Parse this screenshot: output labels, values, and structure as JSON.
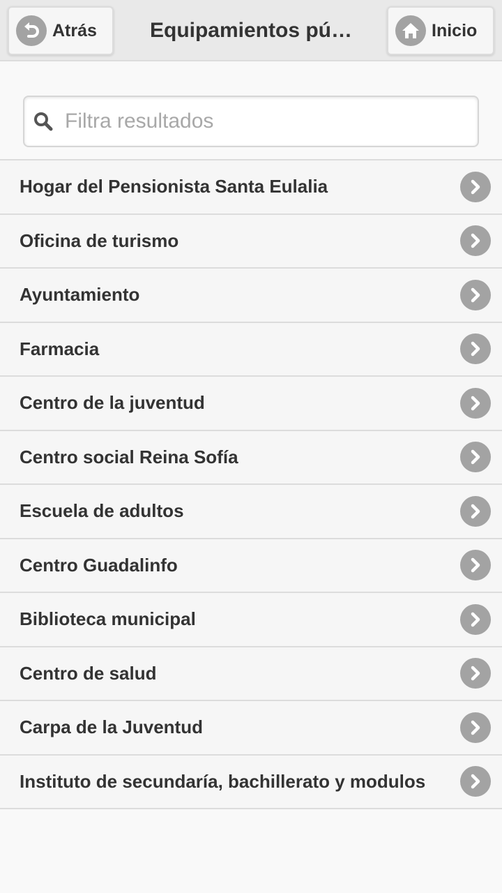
{
  "header": {
    "back_label": "Atrás",
    "title": "Equipamientos pú…",
    "home_label": "Inicio"
  },
  "search": {
    "placeholder": "Filtra resultados",
    "value": ""
  },
  "list": {
    "items": [
      {
        "label": "Hogar del Pensionista Santa Eulalia"
      },
      {
        "label": "Oficina de turismo"
      },
      {
        "label": "Ayuntamiento"
      },
      {
        "label": "Farmacia"
      },
      {
        "label": "Centro de la juventud"
      },
      {
        "label": "Centro social Reina Sofía"
      },
      {
        "label": "Escuela de adultos"
      },
      {
        "label": "Centro Guadalinfo"
      },
      {
        "label": "Biblioteca municipal"
      },
      {
        "label": "Centro de salud"
      },
      {
        "label": "Carpa de la Juventud"
      },
      {
        "label": "Instituto de secundaría, bachillerato y modulos"
      }
    ],
    "item_icon": "chevron-right-icon"
  },
  "colors": {
    "header_bg": "#e9e9e9",
    "icon_circle": "#a3a3a3",
    "list_bg": "#f6f6f6",
    "divider": "#dcdcdc",
    "text": "#333333",
    "placeholder": "#a8a8a8"
  }
}
